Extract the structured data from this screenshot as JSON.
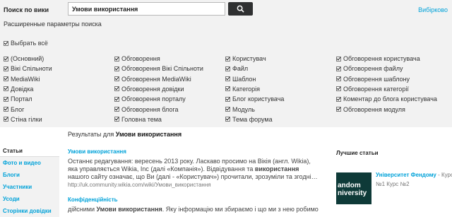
{
  "search": {
    "label": "Поиск по вики",
    "query": "Умови використання",
    "selected_label": "Вибірково"
  },
  "advanced": {
    "title": "Расширенные параметры поиска",
    "select_all": "Выбрать всё"
  },
  "namespaces": [
    [
      "(Основний)",
      "Вікі Спільноти",
      "MediaWiki",
      "Довідка",
      "Портал",
      "Блог",
      "Стіна гілки"
    ],
    [
      "Обговорення",
      "Обговорення Вікі Спільноти",
      "Обговорення MediaWiki",
      "Обговорення довідки",
      "Обговорення порталу",
      "Обговорення блога",
      "Головна тема"
    ],
    [
      "Користувач",
      "Файл",
      "Шаблон",
      "Категорія",
      "Блог користувача",
      "Модуль",
      "Тема форума"
    ],
    [
      "Обговорення користувача",
      "Обговорення файлу",
      "Обговорення шаблону",
      "Обговорення категорії",
      "Коментар до блога користувача",
      "Обговорення модуля"
    ]
  ],
  "results_header": {
    "prefix": "Результаты для",
    "query": "Умови використання"
  },
  "leftnav": [
    "Статьи",
    "Фото и видео",
    "Блоги",
    "Участники",
    "Усоди",
    "Сторінки довідки"
  ],
  "results": [
    {
      "title": "Умови використання",
      "snippet_1": "Останнє редагування: вересень 2013 року. Ласкаво просимо на Вікія (англ. Wikia), яка управляється Wikia, Inc (далі «Компанія»). Відвідування та ",
      "snippet_bold": "використання",
      "snippet_2": " нашого сайту означає, що Ви (далі - «Користувач») прочитали, зрозуміли та згодні…",
      "url": "http://uk.community.wikia.com/wiki/Умови_використання"
    },
    {
      "title": "Конфіденційність",
      "snippet_1": "дійсними ",
      "snippet_bold": "Умови використання",
      "snippet_2": ". Яку інформацію ми збираємо і що ми з нею робимо"
    }
  ],
  "sidebar": {
    "top_articles_title": "Лучшие статьи",
    "logo_text": [
      "andom",
      "niversity"
    ],
    "article_title": "Університет Фендому",
    "article_suffix": " - Курс",
    "article_sub": "№1 Курс №2"
  },
  "colors": {
    "link": "#00a2d9",
    "topbar_bg": "#f2f2f2",
    "button_bg": "#2f3031",
    "logo_bg": "#0e3a38"
  }
}
